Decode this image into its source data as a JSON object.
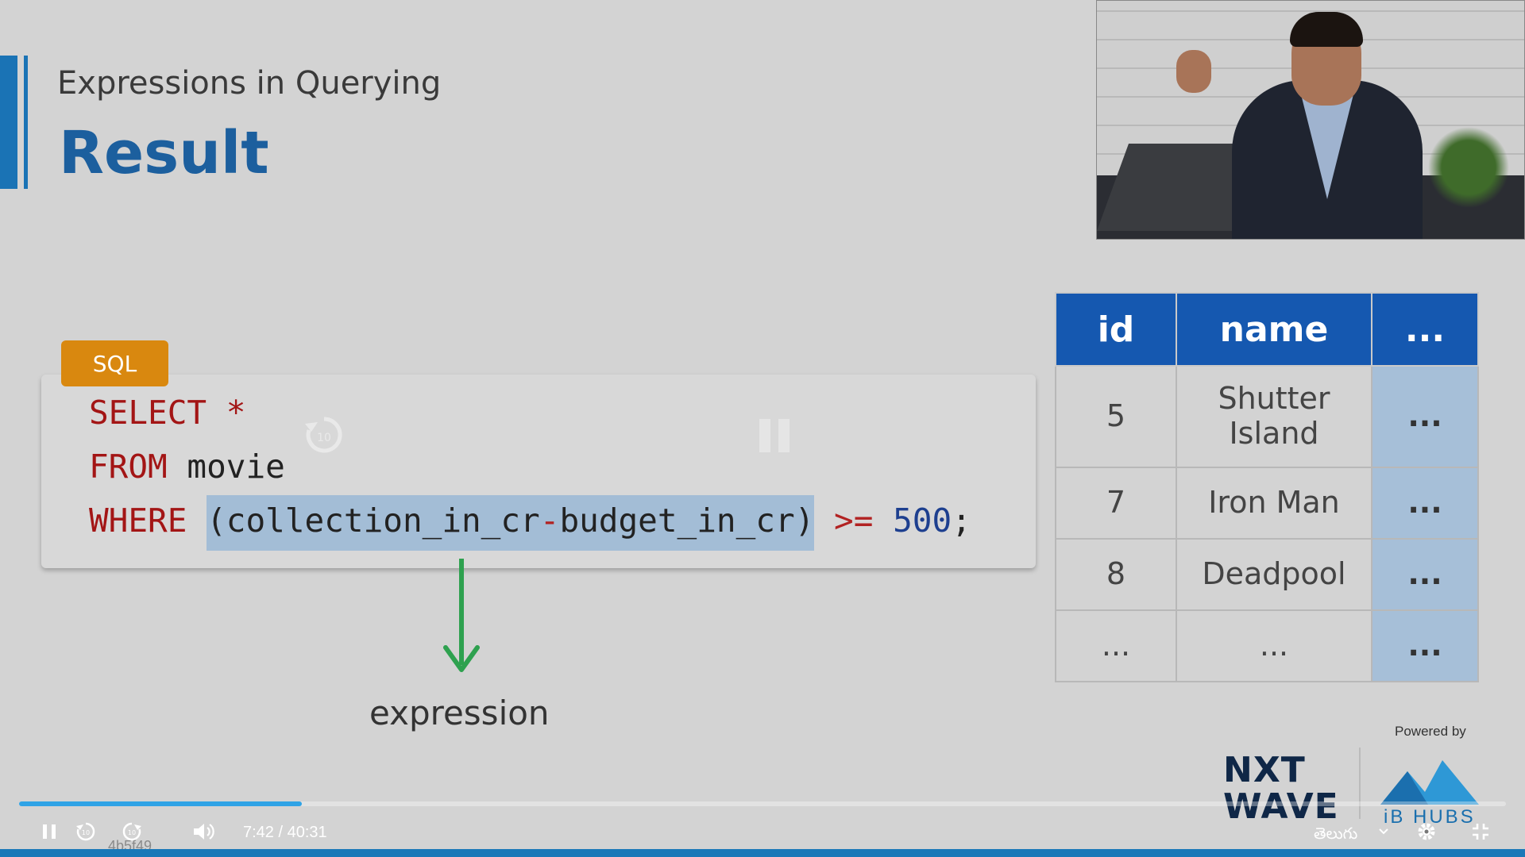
{
  "slide": {
    "subtitle": "Expressions in Querying",
    "title": "Result",
    "code_tag": "SQL",
    "code": {
      "line1": {
        "keyword": "SELECT",
        "rest": " *"
      },
      "line2": {
        "keyword": "FROM",
        "rest": " movie"
      },
      "line3": {
        "keyword": "WHERE",
        "space": " ",
        "expr_part1": "(collection_in_cr",
        "minus": "-",
        "expr_part2": "budget_in_cr)",
        "operator": " >=",
        "value": " 500",
        "end": ";"
      }
    },
    "arrow_label": "expression",
    "table": {
      "headers": [
        "id",
        "name",
        "..."
      ],
      "rows": [
        [
          "5",
          "Shutter Island",
          "..."
        ],
        [
          "7",
          "Iron Man",
          "..."
        ],
        [
          "8",
          "Deadpool",
          "..."
        ],
        [
          "...",
          "...",
          "..."
        ]
      ]
    },
    "branding": {
      "powered_by": "Powered by",
      "logo_line1": "NXT",
      "logo_line2": "WAVE",
      "partner": "iB HUBS"
    }
  },
  "player": {
    "current_time": "7:42",
    "separator": "/",
    "duration": "40:31",
    "progress_fraction": 0.19,
    "language": "తెలుగు",
    "watermark": "4b5f49",
    "colors": {
      "accent": "#2fa3e6",
      "brand": "#1558b0"
    },
    "icons": [
      "pause-icon",
      "rewind-10-icon",
      "forward-10-icon",
      "volume-icon",
      "chevron-down-icon",
      "settings-gear-icon",
      "exit-fullscreen-icon"
    ]
  }
}
